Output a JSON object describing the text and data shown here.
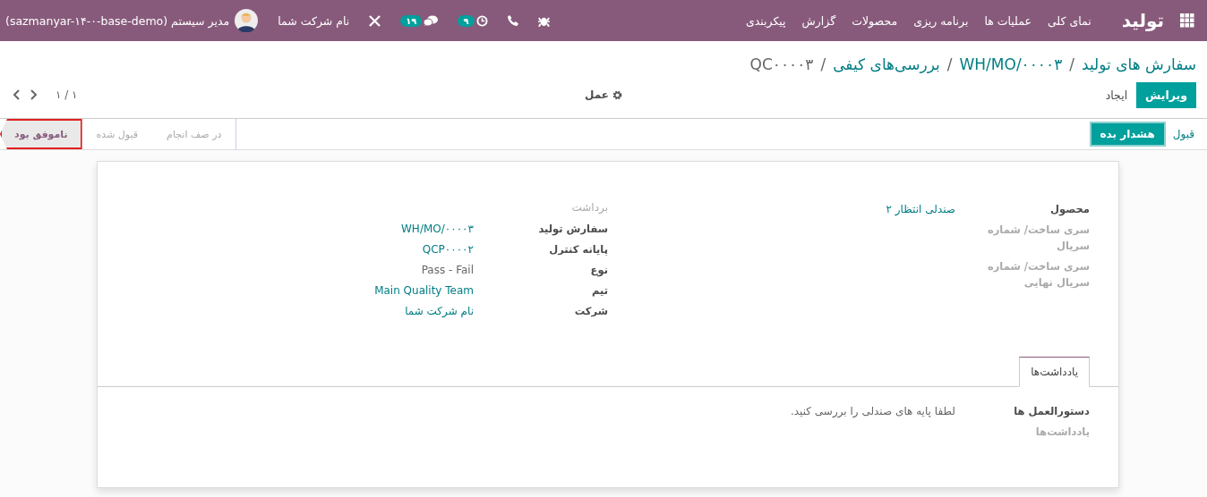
{
  "navbar": {
    "brand": "تولید",
    "menu": [
      "نمای کلی",
      "عملیات ها",
      "برنامه ریزی",
      "محصولات",
      "گزارش",
      "پیکربندی"
    ],
    "systray": {
      "activity_count": "۹",
      "message_count": "۱۹",
      "company": "نام شرکت شما",
      "user": "مدیر سیستم (sazmanyar-۱۴-۰-base-demo)"
    }
  },
  "breadcrumb_separator": "/",
  "breadcrumb": [
    {
      "label": "سفارش های تولید",
      "selected": false
    },
    {
      "label": "WH/MO/۰۰۰۰۳",
      "selected": false
    },
    {
      "label": "بررسی‌های کیفی",
      "selected": false
    },
    {
      "label": "QC۰۰۰۰۳",
      "selected": true
    }
  ],
  "control_buttons": [
    {
      "label": "ویرایش",
      "kind": "primary"
    },
    {
      "label": "ایجاد",
      "kind": "secondary"
    }
  ],
  "action_menu": "عمل",
  "pager": "۱ / ۱",
  "status_buttons": [
    {
      "label": "قبول",
      "kind": "secondary"
    },
    {
      "label": "هشدار بده",
      "kind": "primary"
    }
  ],
  "stages": [
    {
      "label": "در صف انجام",
      "selected": false,
      "highlighted": false
    },
    {
      "label": "قبول شده",
      "selected": false,
      "highlighted": false
    },
    {
      "label": "ناموفق بود",
      "selected": true,
      "highlighted": true
    }
  ],
  "groups": [
    {
      "fields": [
        {
          "label": "محصول",
          "muted": false,
          "value": "صندلی انتظار ۲",
          "link": true
        },
        {
          "label": "سری ساخت/ شماره سریال",
          "muted": true
        },
        {
          "label": "سری ساخت/ شماره سریال نهایی",
          "muted": true
        }
      ]
    },
    {
      "title": "برداشت",
      "fields": [
        {
          "label": "سفارش تولید",
          "muted": false,
          "value": "WH/MO/۰۰۰۰۳",
          "link": true
        },
        {
          "label": "پایانه کنترل",
          "muted": false,
          "value": "QCP۰۰۰۰۲",
          "link": true
        },
        {
          "label": "نوع",
          "muted": false,
          "value": "Pass - Fail",
          "link": false
        },
        {
          "label": "تیم",
          "muted": false,
          "value": "Main Quality Team",
          "link": true
        },
        {
          "label": "شرکت",
          "muted": false,
          "value": "نام شرکت شما",
          "link": true
        }
      ]
    }
  ],
  "notebook": {
    "tabs": [
      {
        "label": "یادداشت‌ها",
        "selected": true
      }
    ],
    "fields": [
      {
        "label": "دستورالعمل ها",
        "muted": false,
        "value": "لطفا پایه های صندلی را بررسی کنید.",
        "link": false
      },
      {
        "label": "یادداشت‌ها",
        "muted": true
      }
    ]
  }
}
